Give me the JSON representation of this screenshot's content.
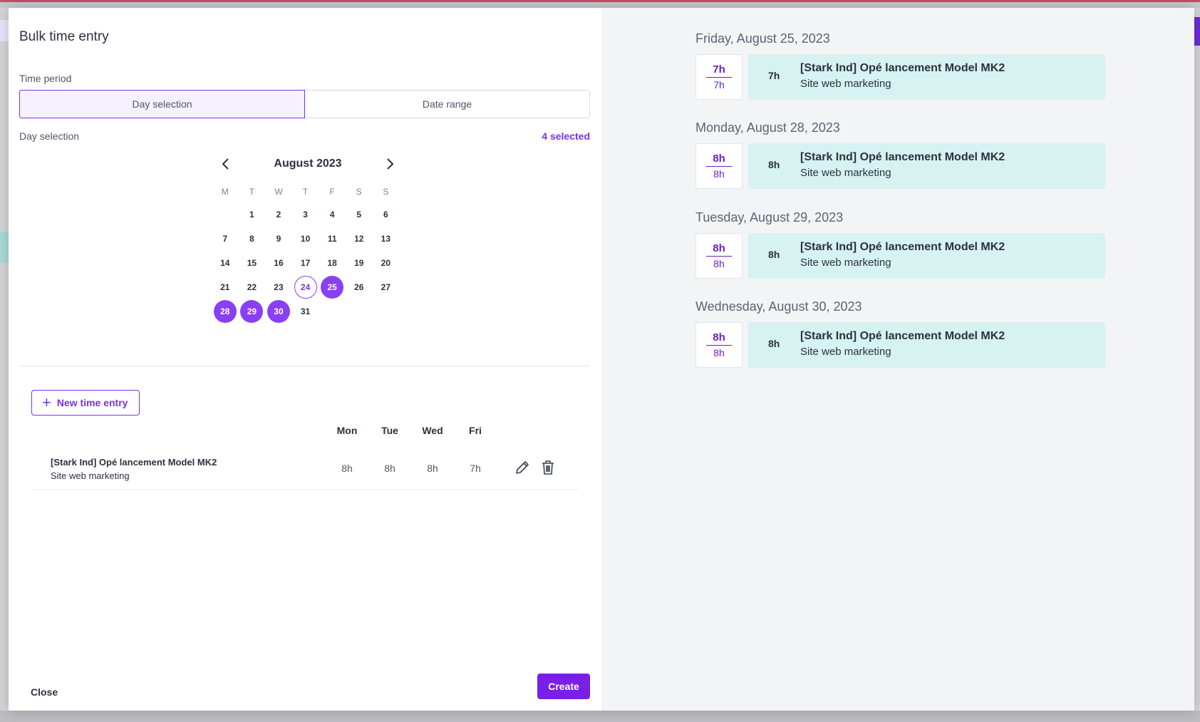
{
  "modal": {
    "title": "Bulk time entry",
    "time_period_label": "Time period",
    "tabs": [
      {
        "label": "Day selection",
        "active": true
      },
      {
        "label": "Date range",
        "active": false
      }
    ],
    "day_selection_label": "Day selection",
    "selected_count": "4 selected"
  },
  "calendar": {
    "month": "August 2023",
    "prev_icon": "chevron-left-icon",
    "next_icon": "chevron-right-icon",
    "weekdays": [
      "M",
      "T",
      "W",
      "T",
      "F",
      "S",
      "S"
    ],
    "days": [
      "1",
      "2",
      "3",
      "4",
      "5",
      "6",
      "7",
      "8",
      "9",
      "10",
      "11",
      "12",
      "13",
      "14",
      "15",
      "16",
      "17",
      "18",
      "19",
      "20",
      "21",
      "22",
      "23",
      "24",
      "25",
      "26",
      "27",
      "28",
      "29",
      "30",
      "31"
    ],
    "today": "24",
    "selected": [
      "25",
      "28",
      "29",
      "30"
    ]
  },
  "entries": {
    "new_entry_label": "New time entry",
    "columns": [
      "Mon",
      "Tue",
      "Wed",
      "Fri"
    ],
    "rows": [
      {
        "project": "[Stark Ind] Opé lancement Model MK2",
        "task": "Site web marketing",
        "hours": [
          "8h",
          "8h",
          "8h",
          "7h"
        ]
      }
    ]
  },
  "footer": {
    "close_label": "Close",
    "create_label": "Create"
  },
  "preview": [
    {
      "date": "Friday, August 25, 2023",
      "total": "7h",
      "capacity": "7h",
      "entry_hours": "7h",
      "project": "[Stark Ind] Opé lancement Model MK2",
      "task": "Site web marketing"
    },
    {
      "date": "Monday, August 28, 2023",
      "total": "8h",
      "capacity": "8h",
      "entry_hours": "8h",
      "project": "[Stark Ind] Opé lancement Model MK2",
      "task": "Site web marketing"
    },
    {
      "date": "Tuesday, August 29, 2023",
      "total": "8h",
      "capacity": "8h",
      "entry_hours": "8h",
      "project": "[Stark Ind] Opé lancement Model MK2",
      "task": "Site web marketing"
    },
    {
      "date": "Wednesday, August 30, 2023",
      "total": "8h",
      "capacity": "8h",
      "entry_hours": "8h",
      "project": "[Stark Ind] Opé lancement Model MK2",
      "task": "Site web marketing"
    }
  ],
  "colors": {
    "accent": "#7b2ff0",
    "selected_day": "#8a3ff2",
    "card_bg": "#d6f2f1",
    "right_pane_bg": "#f3f4f6"
  }
}
